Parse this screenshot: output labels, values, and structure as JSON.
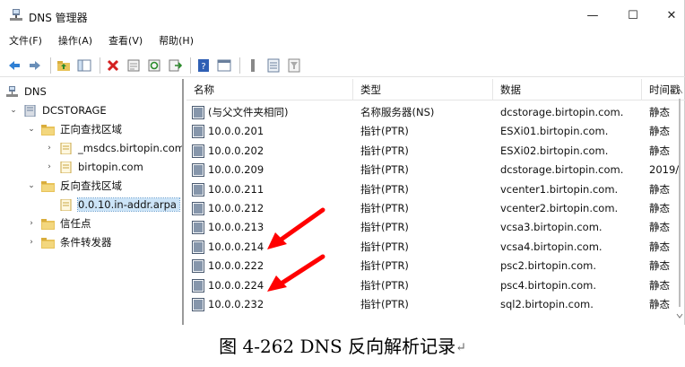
{
  "window": {
    "title": "DNS 管理器",
    "controls": {
      "minimize": "—",
      "maximize": "☐",
      "close": "✕"
    }
  },
  "menu": [
    "文件(F)",
    "操作(A)",
    "查看(V)",
    "帮助(H)"
  ],
  "toolbar": [
    "back-arrow-icon",
    "forward-arrow-icon",
    "up-folder-icon",
    "show-tree-icon",
    "delete-icon",
    "properties-icon",
    "refresh-icon",
    "export-icon",
    "help-icon",
    "console-icon",
    "separator-bar-icon",
    "record-list-icon",
    "filter-icon"
  ],
  "tree": {
    "root": "DNS",
    "server": "DCSTORAGE",
    "forward_zones": "正向查找区域",
    "forward_children": [
      "_msdcs.birtopin.com",
      "birtopin.com"
    ],
    "reverse_zones": "反向查找区域",
    "reverse_children": [
      "0.0.10.in-addr.arpa"
    ],
    "trust_points": "信任点",
    "conditional_forwarders": "条件转发器"
  },
  "list": {
    "columns": [
      "名称",
      "类型",
      "数据",
      "时间戳"
    ],
    "rows": [
      {
        "name": "(与父文件夹相同)",
        "type": "名称服务器(NS)",
        "data": "dcstorage.birtopin.com.",
        "timestamp": "静态"
      },
      {
        "name": "10.0.0.201",
        "type": "指针(PTR)",
        "data": "ESXi01.birtopin.com.",
        "timestamp": "静态"
      },
      {
        "name": "10.0.0.202",
        "type": "指针(PTR)",
        "data": "ESXi02.birtopin.com.",
        "timestamp": "静态"
      },
      {
        "name": "10.0.0.209",
        "type": "指针(PTR)",
        "data": "dcstorage.birtopin.com.",
        "timestamp": "2019/"
      },
      {
        "name": "10.0.0.211",
        "type": "指针(PTR)",
        "data": "vcenter1.birtopin.com.",
        "timestamp": "静态"
      },
      {
        "name": "10.0.0.212",
        "type": "指针(PTR)",
        "data": "vcenter2.birtopin.com.",
        "timestamp": "静态"
      },
      {
        "name": "10.0.0.213",
        "type": "指针(PTR)",
        "data": "vcsa3.birtopin.com.",
        "timestamp": "静态"
      },
      {
        "name": "10.0.0.214",
        "type": "指针(PTR)",
        "data": "vcsa4.birtopin.com.",
        "timestamp": "静态"
      },
      {
        "name": "10.0.0.222",
        "type": "指针(PTR)",
        "data": "psc2.birtopin.com.",
        "timestamp": "静态"
      },
      {
        "name": "10.0.0.224",
        "type": "指针(PTR)",
        "data": "psc4.birtopin.com.",
        "timestamp": "静态"
      },
      {
        "name": "10.0.0.232",
        "type": "指针(PTR)",
        "data": "sql2.birtopin.com.",
        "timestamp": "静态"
      }
    ]
  },
  "caption": "图 4-262 DNS 反向解析记录",
  "caption_mark": "↵",
  "colors": {
    "selection": "#cce4f7",
    "arrow": "#ff0000",
    "folder": "#e8c35a"
  }
}
